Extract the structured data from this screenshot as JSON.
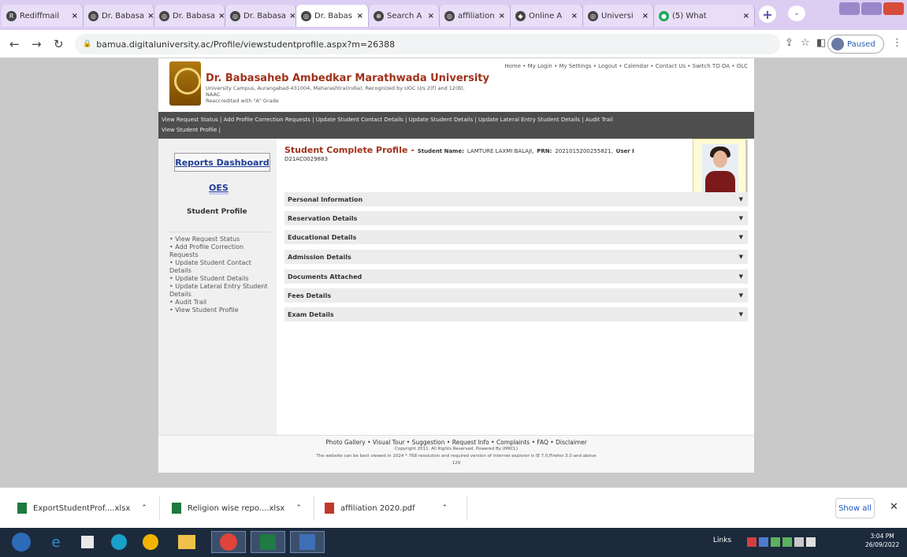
{
  "browser": {
    "tabs": [
      {
        "label": "Rediffmail",
        "icon": "rediff-icon"
      },
      {
        "label": "Dr. Babasa",
        "icon": "site-icon"
      },
      {
        "label": "Dr. Babasa",
        "icon": "site-icon"
      },
      {
        "label": "Dr. Babasa",
        "icon": "site-icon"
      },
      {
        "label": "Dr. Babas",
        "icon": "site-icon",
        "active": true
      },
      {
        "label": "Search A",
        "icon": "search-icon"
      },
      {
        "label": "affiliation",
        "icon": "site-icon"
      },
      {
        "label": "Online A",
        "icon": "site-icon"
      },
      {
        "label": "Universi",
        "icon": "site-icon"
      },
      {
        "label": "(5) What",
        "icon": "whatsapp-icon"
      }
    ],
    "url": "bamua.digitaluniversity.ac/Profile/viewstudentprofile.aspx?m=26388",
    "profile_status": "Paused"
  },
  "header": {
    "university_name": "Dr. Babasaheb Ambedkar Marathwada University",
    "sub_line1": "University Campus, Aurangabad-431004, Maharashtra(India). Recognized by UGC U/s 2(f) and 12(B), NAAC",
    "sub_line2": "Reaccredited with \"A\" Grade",
    "top_links": "Home  • My Login  • My Settings  • Logout  • Calendar  • Contact Us  • Switch TO OA  • OLC"
  },
  "menubar": {
    "line1": "View Request Status | Add Profile Correction Requests | Update Student Contact Details | Update Student Details | Update Lateral Entry Student Details | Audit Trail",
    "line2": "View Student Profile |"
  },
  "sidebar": {
    "reports_dashboard": "Reports Dashboard",
    "oes": "OES",
    "title": "Student Profile",
    "links": [
      "• View Request Status",
      "• Add Profile Correction Requests",
      "• Update Student Contact Details",
      "• Update Student Details",
      "• Update Lateral Entry Student Details",
      "• Audit Trail",
      "• View Student Profile"
    ]
  },
  "profile": {
    "title": "Student Complete Profile",
    "dash": " - ",
    "student_name_label": "Student Name:",
    "student_name_value": "LAMTURE LAXMI BALAJI,",
    "prn_label": "PRN:",
    "prn_value": "2021015200255821,",
    "user_label": "User I",
    "user_value": "D21AC0029883",
    "sections": [
      "Personal Information",
      "Reservation Details",
      "Educational Details",
      "Admission Details",
      "Documents Attached",
      "Fees Details",
      "Exam Details"
    ]
  },
  "footer": {
    "links": "Photo Gallery  • Visual Tour  • Suggestion  • Request Info  • Complaints  • FAQ  • Disclaimer",
    "copyright": "Copyright 2011. All Rights Reserved. Powered By (MKCL)",
    "browser_note": "The website can be best viewed in 1024 * 768 resolution and required version of internet explorer is IE 7.0,Firefox 3.0 and above",
    "counter": "129"
  },
  "downloads": [
    {
      "name": "ExportStudentProf....xlsx"
    },
    {
      "name": "Religion wise repo....xlsx"
    },
    {
      "name": "affiliation 2020.pdf"
    }
  ],
  "downloads_show_all": "Show all",
  "taskbar": {
    "links_label": "Links",
    "time": "3:04 PM",
    "date": "26/09/2022"
  }
}
